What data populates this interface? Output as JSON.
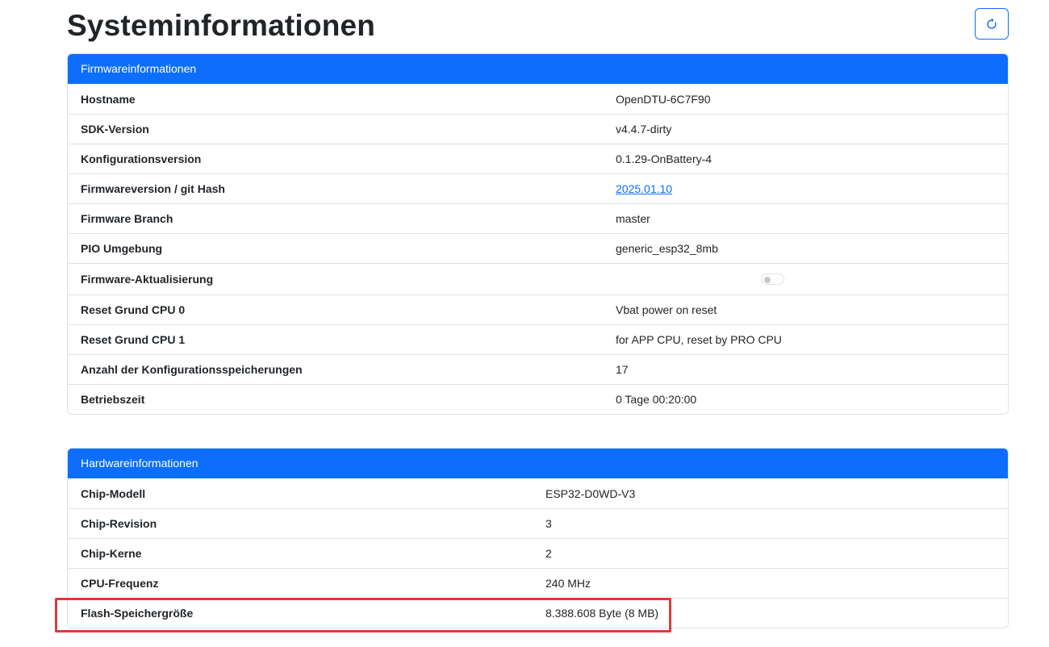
{
  "page": {
    "title": "Systeminformationen",
    "reload_icon": "refresh-icon"
  },
  "firmware": {
    "header": "Firmwareinformationen",
    "rows": [
      {
        "label": "Hostname",
        "value": "OpenDTU-6C7F90"
      },
      {
        "label": "SDK-Version",
        "value": "v4.4.7-dirty"
      },
      {
        "label": "Konfigurationsversion",
        "value": "0.1.29-OnBattery-4"
      },
      {
        "label": "Firmwareversion / git Hash",
        "value": "2025.01.10"
      },
      {
        "label": "Firmware Branch",
        "value": "master"
      },
      {
        "label": "PIO Umgebung",
        "value": "generic_esp32_8mb"
      },
      {
        "label": "Firmware-Aktualisierung",
        "value": false
      },
      {
        "label": "Reset Grund CPU 0",
        "value": "Vbat power on reset"
      },
      {
        "label": "Reset Grund CPU 1",
        "value": "for APP CPU, reset by PRO CPU"
      },
      {
        "label": "Anzahl der Konfigurationsspeicherungen",
        "value": "17"
      },
      {
        "label": "Betriebszeit",
        "value": "0 Tage 00:20:00"
      }
    ]
  },
  "hardware": {
    "header": "Hardwareinformationen",
    "rows": [
      {
        "label": "Chip-Modell",
        "value": "ESP32-D0WD-V3"
      },
      {
        "label": "Chip-Revision",
        "value": "3"
      },
      {
        "label": "Chip-Kerne",
        "value": "2"
      },
      {
        "label": "CPU-Frequenz",
        "value": "240 MHz"
      },
      {
        "label": "Flash-Speichergröße",
        "value": "8.388.608 Byte (8 MB)"
      }
    ]
  },
  "colors": {
    "primary": "#0d6efd",
    "highlight": "#e0383e",
    "border": "#dee2e6"
  }
}
